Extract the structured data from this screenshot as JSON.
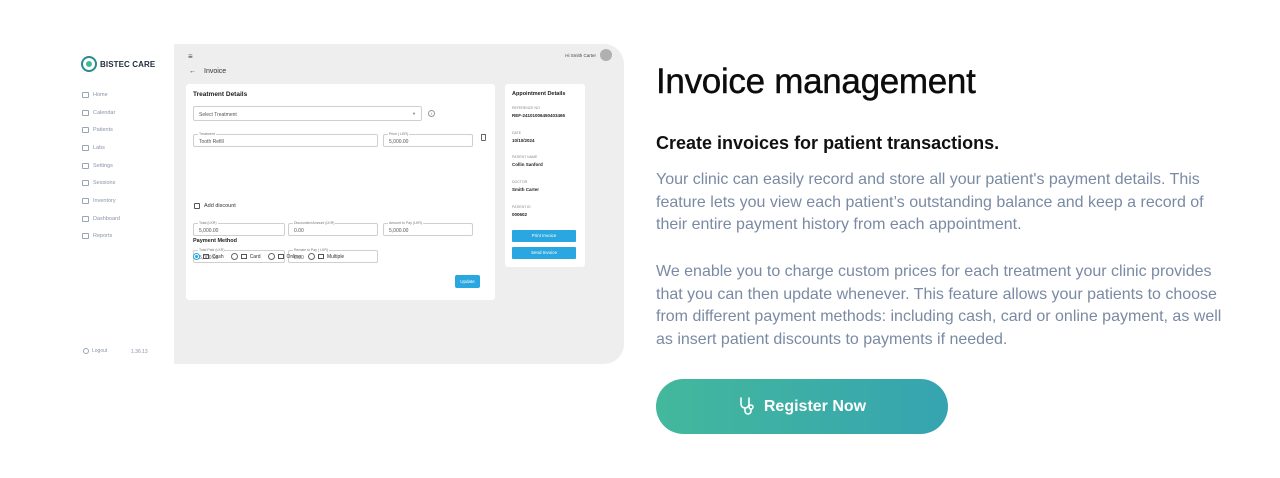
{
  "mockup": {
    "brand": "BISTEC CARE",
    "nav": [
      "Home",
      "Calendar",
      "Patients",
      "Labs",
      "Settings",
      "Sessions",
      "Inventory",
      "Dashboard",
      "Reports"
    ],
    "logout": "Logout",
    "version": "1.36.13",
    "user_greeting": "Hi Smith Carter",
    "page_title": "Invoice",
    "treatment_title": "Treatment Details",
    "select_placeholder": "Select Treatment",
    "treatment_label": "Treatment",
    "treatment_value": "Tooth Refill",
    "price_label": "Price ( LKR)",
    "price_value": "5,000.00",
    "add_discount": "Add discount",
    "total_label": "Total (LKR)",
    "total_value": "5,000.00",
    "discount_label": "Discounted Amount (LKR)",
    "discount_value": "0.00",
    "to_pay_label": "Amount to Pay (LKR)",
    "to_pay_value": "5,000.00",
    "total_paid_label": "Total Paid (LKR)",
    "total_paid_value": "5,000.00",
    "remain_label": "Remain to Pay ( LKR)",
    "remain_value": "0.00",
    "payment_method": "Payment Method",
    "methods": [
      "Cash",
      "Card",
      "Online",
      "Multiple"
    ],
    "update": "Update",
    "appointment": {
      "title": "Appointment Details",
      "ref_label": "REFERENCE NO",
      "ref_value": "REF-24101006450403465",
      "date_label": "DATE",
      "date_value": "10/10/2024",
      "patient_label": "PATIENT NAME",
      "patient_value": "Collin Sanford",
      "doctor_label": "DOCTOR",
      "doctor_value": "Smith Carter",
      "patient_id_label": "PATIENT ID",
      "patient_id_value": "000602",
      "print": "Print Invoice",
      "send": "Send Invoice"
    }
  },
  "content": {
    "heading": "Invoice management",
    "subheading": "Create invoices for patient transactions.",
    "para1": "Your clinic can easily record and store all your patient's payment details. This feature lets you view each patient’s outstanding balance and keep a record of their entire payment history from each appointment.",
    "para2": "We enable you to charge custom prices for each treatment your clinic provides that you can then update whenever. This feature allows your patients to choose from different payment methods: including cash, card or online payment, as well as insert patient discounts to payments if needed.",
    "cta": "Register Now"
  }
}
